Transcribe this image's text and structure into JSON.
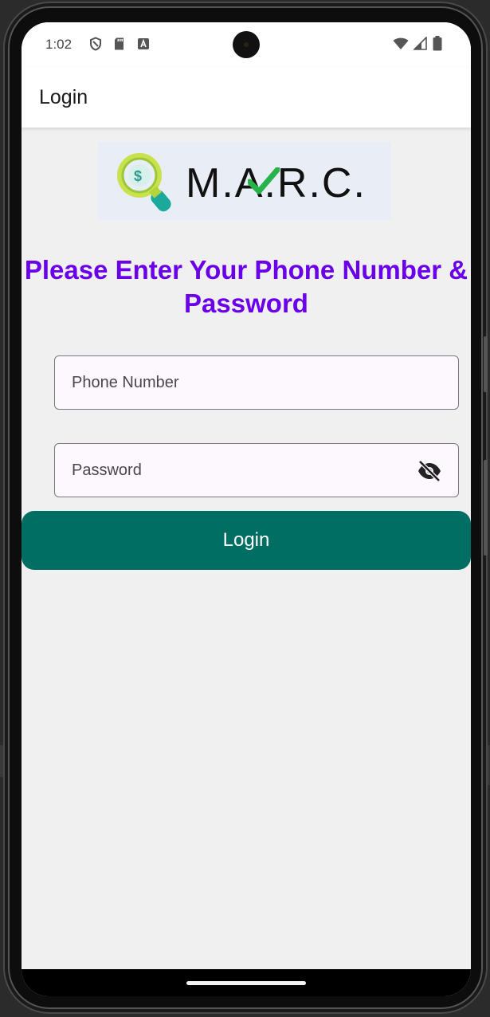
{
  "status_bar": {
    "time": "1:02",
    "left_icons": [
      "shield-icon",
      "sd-card-icon",
      "font-a-icon"
    ],
    "right_icons": [
      "wifi-icon",
      "cellular-signal-icon",
      "battery-icon"
    ]
  },
  "app_bar": {
    "title": "Login"
  },
  "logo": {
    "text": "M.A.R.C.",
    "accent_color": "#27b34a"
  },
  "heading": "Please Enter Your Phone Number & Password",
  "form": {
    "phone_placeholder": "Phone Number",
    "password_placeholder": "Password",
    "visibility_icon": "eye-off-icon",
    "login_label": "Login"
  },
  "colors": {
    "heading": "#6a00e8",
    "primary_button": "#006e62",
    "screen_background": "#f0f0f0"
  }
}
